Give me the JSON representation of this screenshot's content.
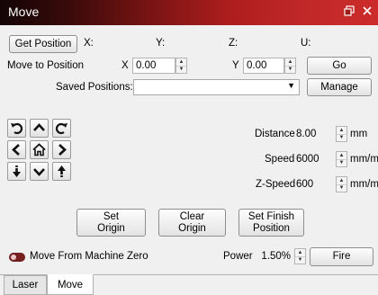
{
  "window": {
    "title": "Move",
    "restore_icon": "restore-window-icon",
    "close_icon": "close-icon"
  },
  "position": {
    "get_position_label": "Get Position",
    "x_label": "X:",
    "y_label": "Y:",
    "z_label": "Z:",
    "u_label": "U:"
  },
  "move_to": {
    "label": "Move to Position",
    "x_label": "X",
    "x_value": "0.00",
    "y_label": "Y",
    "y_value": "0.00",
    "go_label": "Go"
  },
  "saved_positions": {
    "label": "Saved Positions:",
    "selected": "",
    "manage_label": "Manage"
  },
  "jog": {
    "icons": [
      "rotate-ccw-icon",
      "arrow-up-icon",
      "rotate-cw-icon",
      "arrow-left-icon",
      "home-icon",
      "arrow-right-icon",
      "z-down-icon",
      "arrow-down-icon",
      "z-up-icon"
    ]
  },
  "settings": {
    "distance_label": "Distance",
    "distance_value": "8.00",
    "distance_unit": "mm",
    "speed_label": "Speed",
    "speed_value": "6000",
    "speed_unit": "mm/m",
    "zspeed_label": "Z-Speed",
    "zspeed_value": "600",
    "zspeed_unit": "mm/m"
  },
  "actions": {
    "set_origin_line1": "Set",
    "set_origin_line2": "Origin",
    "clear_origin_line1": "Clear",
    "clear_origin_line2": "Origin",
    "set_finish_line1": "Set Finish",
    "set_finish_line2": "Position"
  },
  "footer": {
    "move_from_zero_label": "Move From Machine Zero",
    "move_from_zero_on": true,
    "power_label": "Power",
    "power_value": "1.50%",
    "fire_label": "Fire"
  },
  "tabs": [
    {
      "label": "Laser",
      "active": false
    },
    {
      "label": "Move",
      "active": true
    }
  ],
  "colors": {
    "titlebar_start": "#140505",
    "titlebar_end": "#cc2b2b",
    "toggle_on": "#7a1f1f"
  }
}
